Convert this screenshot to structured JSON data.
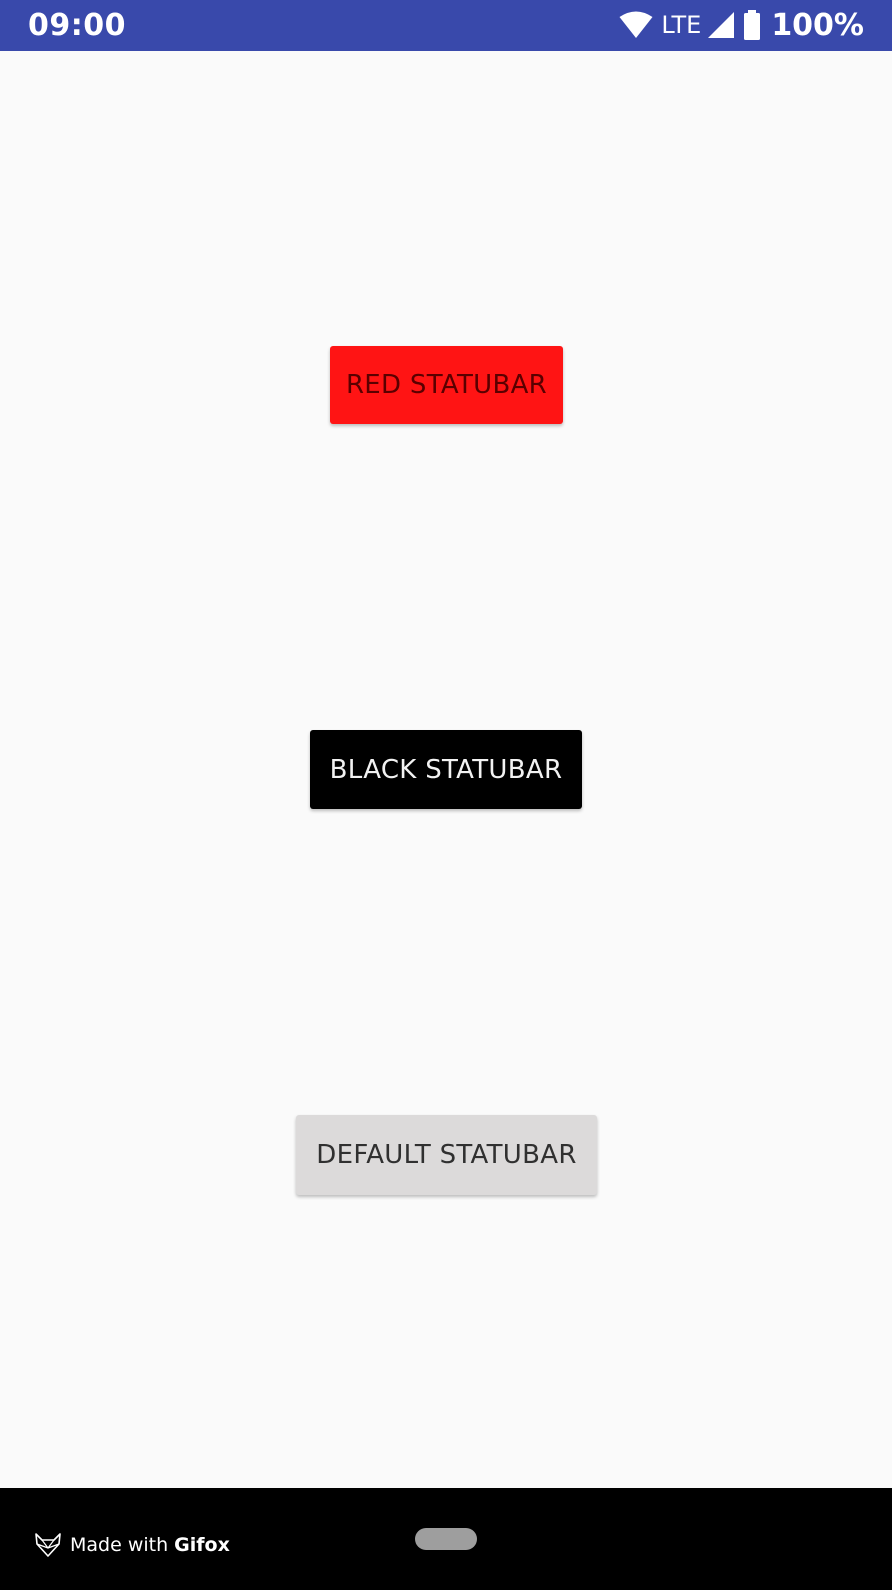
{
  "status_bar": {
    "time": "09:00",
    "network": "LTE",
    "battery": "100%",
    "icons": [
      "wifi-icon",
      "cellular-signal-icon",
      "battery-icon"
    ],
    "background_color": "#3949ab"
  },
  "buttons": {
    "red": {
      "label": "RED STATUBAR",
      "color": "#ff1414"
    },
    "black": {
      "label": "BLACK STATUBAR",
      "color": "#000000"
    },
    "default": {
      "label": "DEFAULT STATUBAR",
      "color": "#dcdada"
    }
  },
  "navigation_bar": {
    "icons": [
      "home-pill-icon"
    ]
  },
  "watermark": {
    "made_with": "Made with",
    "brand": "Gifox",
    "icon": "fox-logo-icon"
  }
}
